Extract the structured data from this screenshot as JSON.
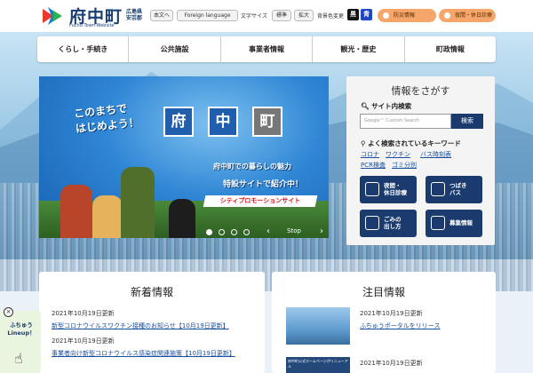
{
  "header": {
    "site_title": "府中町",
    "site_subtitle": "Fuchu Town Website",
    "prefecture": [
      "広島県",
      "安芸郡"
    ],
    "text_label": "本文へ",
    "language_label": "Foreign language",
    "font_size_label": "文字サイズ",
    "font_size_standard": "標準",
    "font_size_large": "拡大",
    "color_change_label": "背景色変更",
    "color_black": "黒",
    "color_blue": "青",
    "disaster_info": "防災情報",
    "night_clinic": "夜間・休日診療"
  },
  "nav": {
    "items": [
      {
        "label": "くらし・手続き"
      },
      {
        "label": "公共施設"
      },
      {
        "label": "事業者情報"
      },
      {
        "label": "観光・歴史"
      },
      {
        "label": "町政情報"
      }
    ]
  },
  "slider": {
    "catch_line1": "このまちで",
    "catch_line2": "はじめよう！",
    "kanji": [
      "府",
      "中",
      "町"
    ],
    "text1": "府中町での暮らしの魅力",
    "text2": "特設サイトで紹介中！",
    "banner": "シティプロモーションサイト",
    "stop_label": "Stop"
  },
  "search": {
    "title": "情報をさがす",
    "site_search_label": "サイト内検索",
    "placeholder": "Google™ Custom Search",
    "button": "検索",
    "keywords_title": "よく検索されているキーワード",
    "keywords": [
      "コロナ",
      "ワクチン",
      "バス時刻表",
      "PCR検査",
      "ゴミ分別"
    ],
    "quick_buttons": [
      {
        "label_line1": "夜間・",
        "label_line2": "休日診療"
      },
      {
        "label_line1": "つばき",
        "label_line2": "バス"
      },
      {
        "label_line1": "ごみの",
        "label_line2": "出し方"
      },
      {
        "label_line1": "募集情報",
        "label_line2": ""
      }
    ]
  },
  "news": {
    "title": "新着情報",
    "items": [
      {
        "date": "2021年10月19日更新",
        "text": "新型コロナウイルスワクチン接種のお知らせ【10月19日更新】"
      },
      {
        "date": "2021年10月19日更新",
        "text": "事業者向け新型コロナウイルス感染症関連施策【10月19日更新】"
      }
    ]
  },
  "featured": {
    "title": "注目情報",
    "items": [
      {
        "date": "2021年10月19日更新",
        "text": "ふちゅうポータルをリリース"
      },
      {
        "date": "2021年10月19日更新",
        "text": ""
      }
    ],
    "thumb2_text": "府中町公式ホームページがリニューアル"
  },
  "lineup": {
    "close": "×",
    "line1": "ふちゅう",
    "line2": "Lineup！"
  }
}
